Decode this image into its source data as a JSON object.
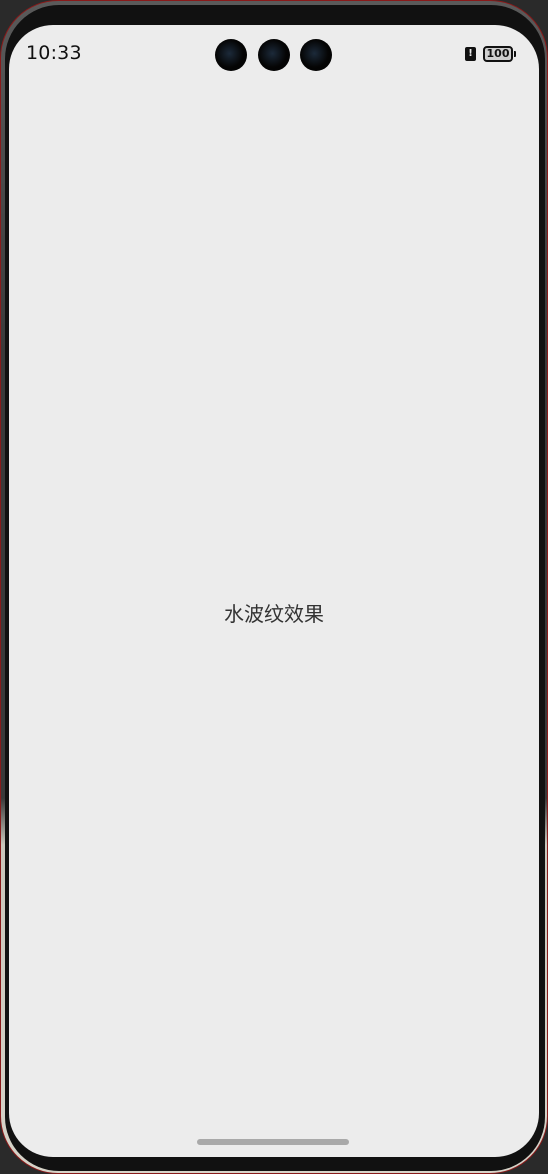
{
  "status_bar": {
    "time": "10:33",
    "battery_level": "100",
    "alert_icon": "battery-alert-icon"
  },
  "main": {
    "center_text": "水波纹效果"
  },
  "colors": {
    "screen_background": "#ececec",
    "text": "#333333",
    "home_indicator": "#a9a9a9"
  }
}
